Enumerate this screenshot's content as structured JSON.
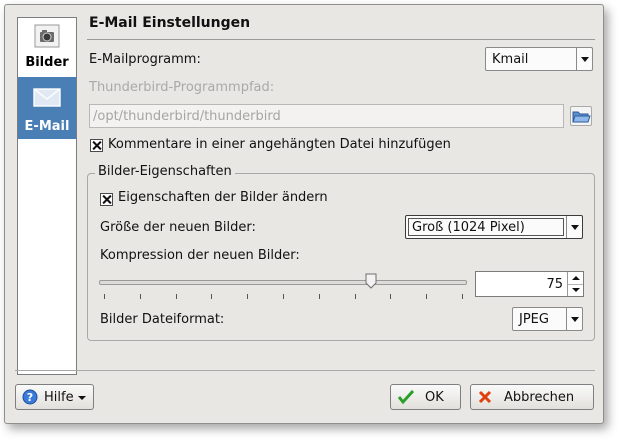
{
  "sidebar": {
    "items": [
      {
        "label": "Bilder",
        "icon": "camera-icon",
        "selected": false
      },
      {
        "label": "E-Mail",
        "icon": "envelope-icon",
        "selected": true
      }
    ]
  },
  "header": {
    "title": "E-Mail Einstellungen"
  },
  "email": {
    "program_label": "E-Mailprogramm:",
    "program_value": "Kmail",
    "thunderbird_path_label": "Thunderbird-Programmpfad:",
    "thunderbird_path_value": "/opt/thunderbird/thunderbird",
    "attach_comments_label": "Kommentare in einer angehängten Datei hinzufügen",
    "attach_comments_checked": true
  },
  "image_props": {
    "group_title": "Bilder-Eigenschaften",
    "change_props_label": "Eigenschaften der Bilder ändern",
    "change_props_checked": true,
    "size_label": "Größe der neuen Bilder:",
    "size_value": "Groß (1024 Pixel)",
    "compression_label": "Kompression der neuen Bilder:",
    "compression_value": "75",
    "format_label": "Bilder Dateiformat:",
    "format_value": "JPEG"
  },
  "buttons": {
    "help": "Hilfe",
    "ok": "OK",
    "cancel": "Abbrechen"
  },
  "colors": {
    "selected_sidebar": "#4a7fb5",
    "ok_check": "#2aa02a",
    "cancel_x": "#e04010",
    "help_icon": "#3a7ad8"
  }
}
